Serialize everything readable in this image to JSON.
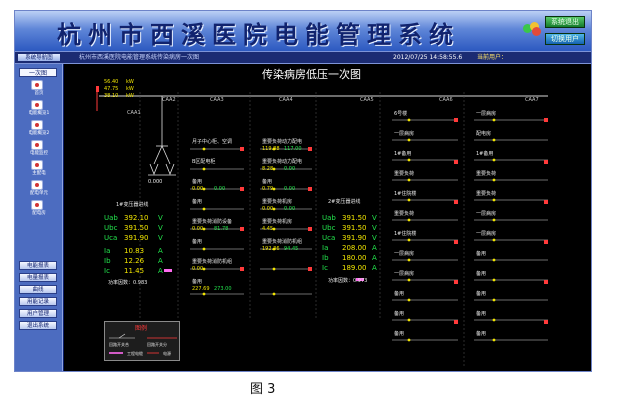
{
  "header": {
    "title": "杭州市西溪医院电能管理系统",
    "button_top": "系统退出",
    "button_bottom": "切换用户"
  },
  "statusbar": {
    "nav_header": "系统导航图",
    "path": "杭州市西溪医院电能管理系统传染病房一次图",
    "datetime": "2012/07/25 14:58:55.6",
    "user": "当前用户："
  },
  "sidebar": {
    "selected": "一次图",
    "items": [
      "首页",
      "电能概览1",
      "电能概览2",
      "电能监控",
      "主配电",
      "配电单元",
      "配电房"
    ],
    "buttons": [
      "电能报表",
      "电量报表",
      "曲线",
      "用能记录",
      "用户管理",
      "退出系统"
    ]
  },
  "main": {
    "title": "传染病房低压一次图",
    "cabinets": [
      "CAA1",
      "CAA2",
      "CAA3",
      "CAA4",
      "CAA5",
      "CAA6",
      "CAA7"
    ],
    "transformer1": {
      "name": "1#变压器进线",
      "sum": "0.000",
      "uab_label": "Uab",
      "uab": "392.10",
      "ubc_label": "Ubc",
      "ubc": "391.50",
      "uca_label": "Uca",
      "uca": "391.90",
      "v": "V",
      "ia_label": "Ia",
      "ia": "10.83",
      "ib_label": "Ib",
      "ib": "12.26",
      "ic_label": "Ic",
      "ic": "11.45",
      "a": "A",
      "pf": "功率因数：0.983"
    },
    "transformer2": {
      "name": "2#变压器进线",
      "uab": "391.50",
      "ubc": "391.50",
      "uca": "391.90",
      "ia": "208.00",
      "ib": "180.00",
      "ic": "189.00",
      "pf": "功率因数：0.973"
    },
    "top_readings": {
      "p": "56.40",
      "q": "47.75",
      "s": "38.10",
      "unit": "kW"
    },
    "feeders": {
      "col3": [
        {
          "name": "月子中心柜、空调",
          "v1": "",
          "v2": "",
          "u": "kW"
        },
        {
          "name": "B区配电柜",
          "v1": "",
          "v2": "",
          "u": "kW"
        },
        {
          "name": "备用",
          "v1": "0.00",
          "v2": "0.00",
          "u": "kW"
        },
        {
          "name": "备用",
          "v1": "",
          "v2": "",
          "u": "kW"
        },
        {
          "name": "重要负荷消防设备",
          "v1": "0.00",
          "v2": "81.78",
          "u": "kW"
        },
        {
          "name": "备用",
          "v1": "",
          "v2": "",
          "u": "kW"
        },
        {
          "name": "重要负荷消防机组",
          "v1": "0.00",
          "v2": "",
          "u": "kW"
        },
        {
          "name": "备用",
          "v1": "227.69",
          "v2": "273.00",
          "u": "kW"
        }
      ],
      "col4": [
        {
          "name": "重要负荷动力配电",
          "v1": "119.88",
          "v2": "117.00",
          "u": "kW"
        },
        {
          "name": "重要负荷动力配电",
          "v1": "8.28",
          "v2": "0.00",
          "u": "kW"
        },
        {
          "name": "备用",
          "v1": "0.79",
          "v2": "0.00",
          "u": "kW"
        },
        {
          "name": "重要负荷机房",
          "v1": "0.00",
          "v2": "0.00",
          "u": "kW"
        },
        {
          "name": "重要负荷机房",
          "v1": "4.45",
          "v2": "",
          "u": "kW"
        },
        {
          "name": "重要负荷消防机组",
          "v1": "192.36",
          "v2": "94.45",
          "u": "kW"
        }
      ],
      "col6": [
        "6号楼",
        "一层病房",
        "1#备用",
        "重要负荷",
        "1#住院楼",
        "重要负荷",
        "1#住院楼",
        "一层病房",
        "一层病房",
        "备用",
        "备用",
        "备用"
      ],
      "col7": [
        "一层病房",
        "配电房",
        "1#备用",
        "重要负荷",
        "重要负荷",
        "一层病房",
        "一层病房",
        "备用",
        "备用",
        "备用",
        "备用",
        "备用"
      ]
    }
  },
  "legend": {
    "title": "图例",
    "items": [
      "回路开关合",
      "回路开关分",
      "电源",
      "工程电缆"
    ]
  },
  "caption": "图 3"
}
